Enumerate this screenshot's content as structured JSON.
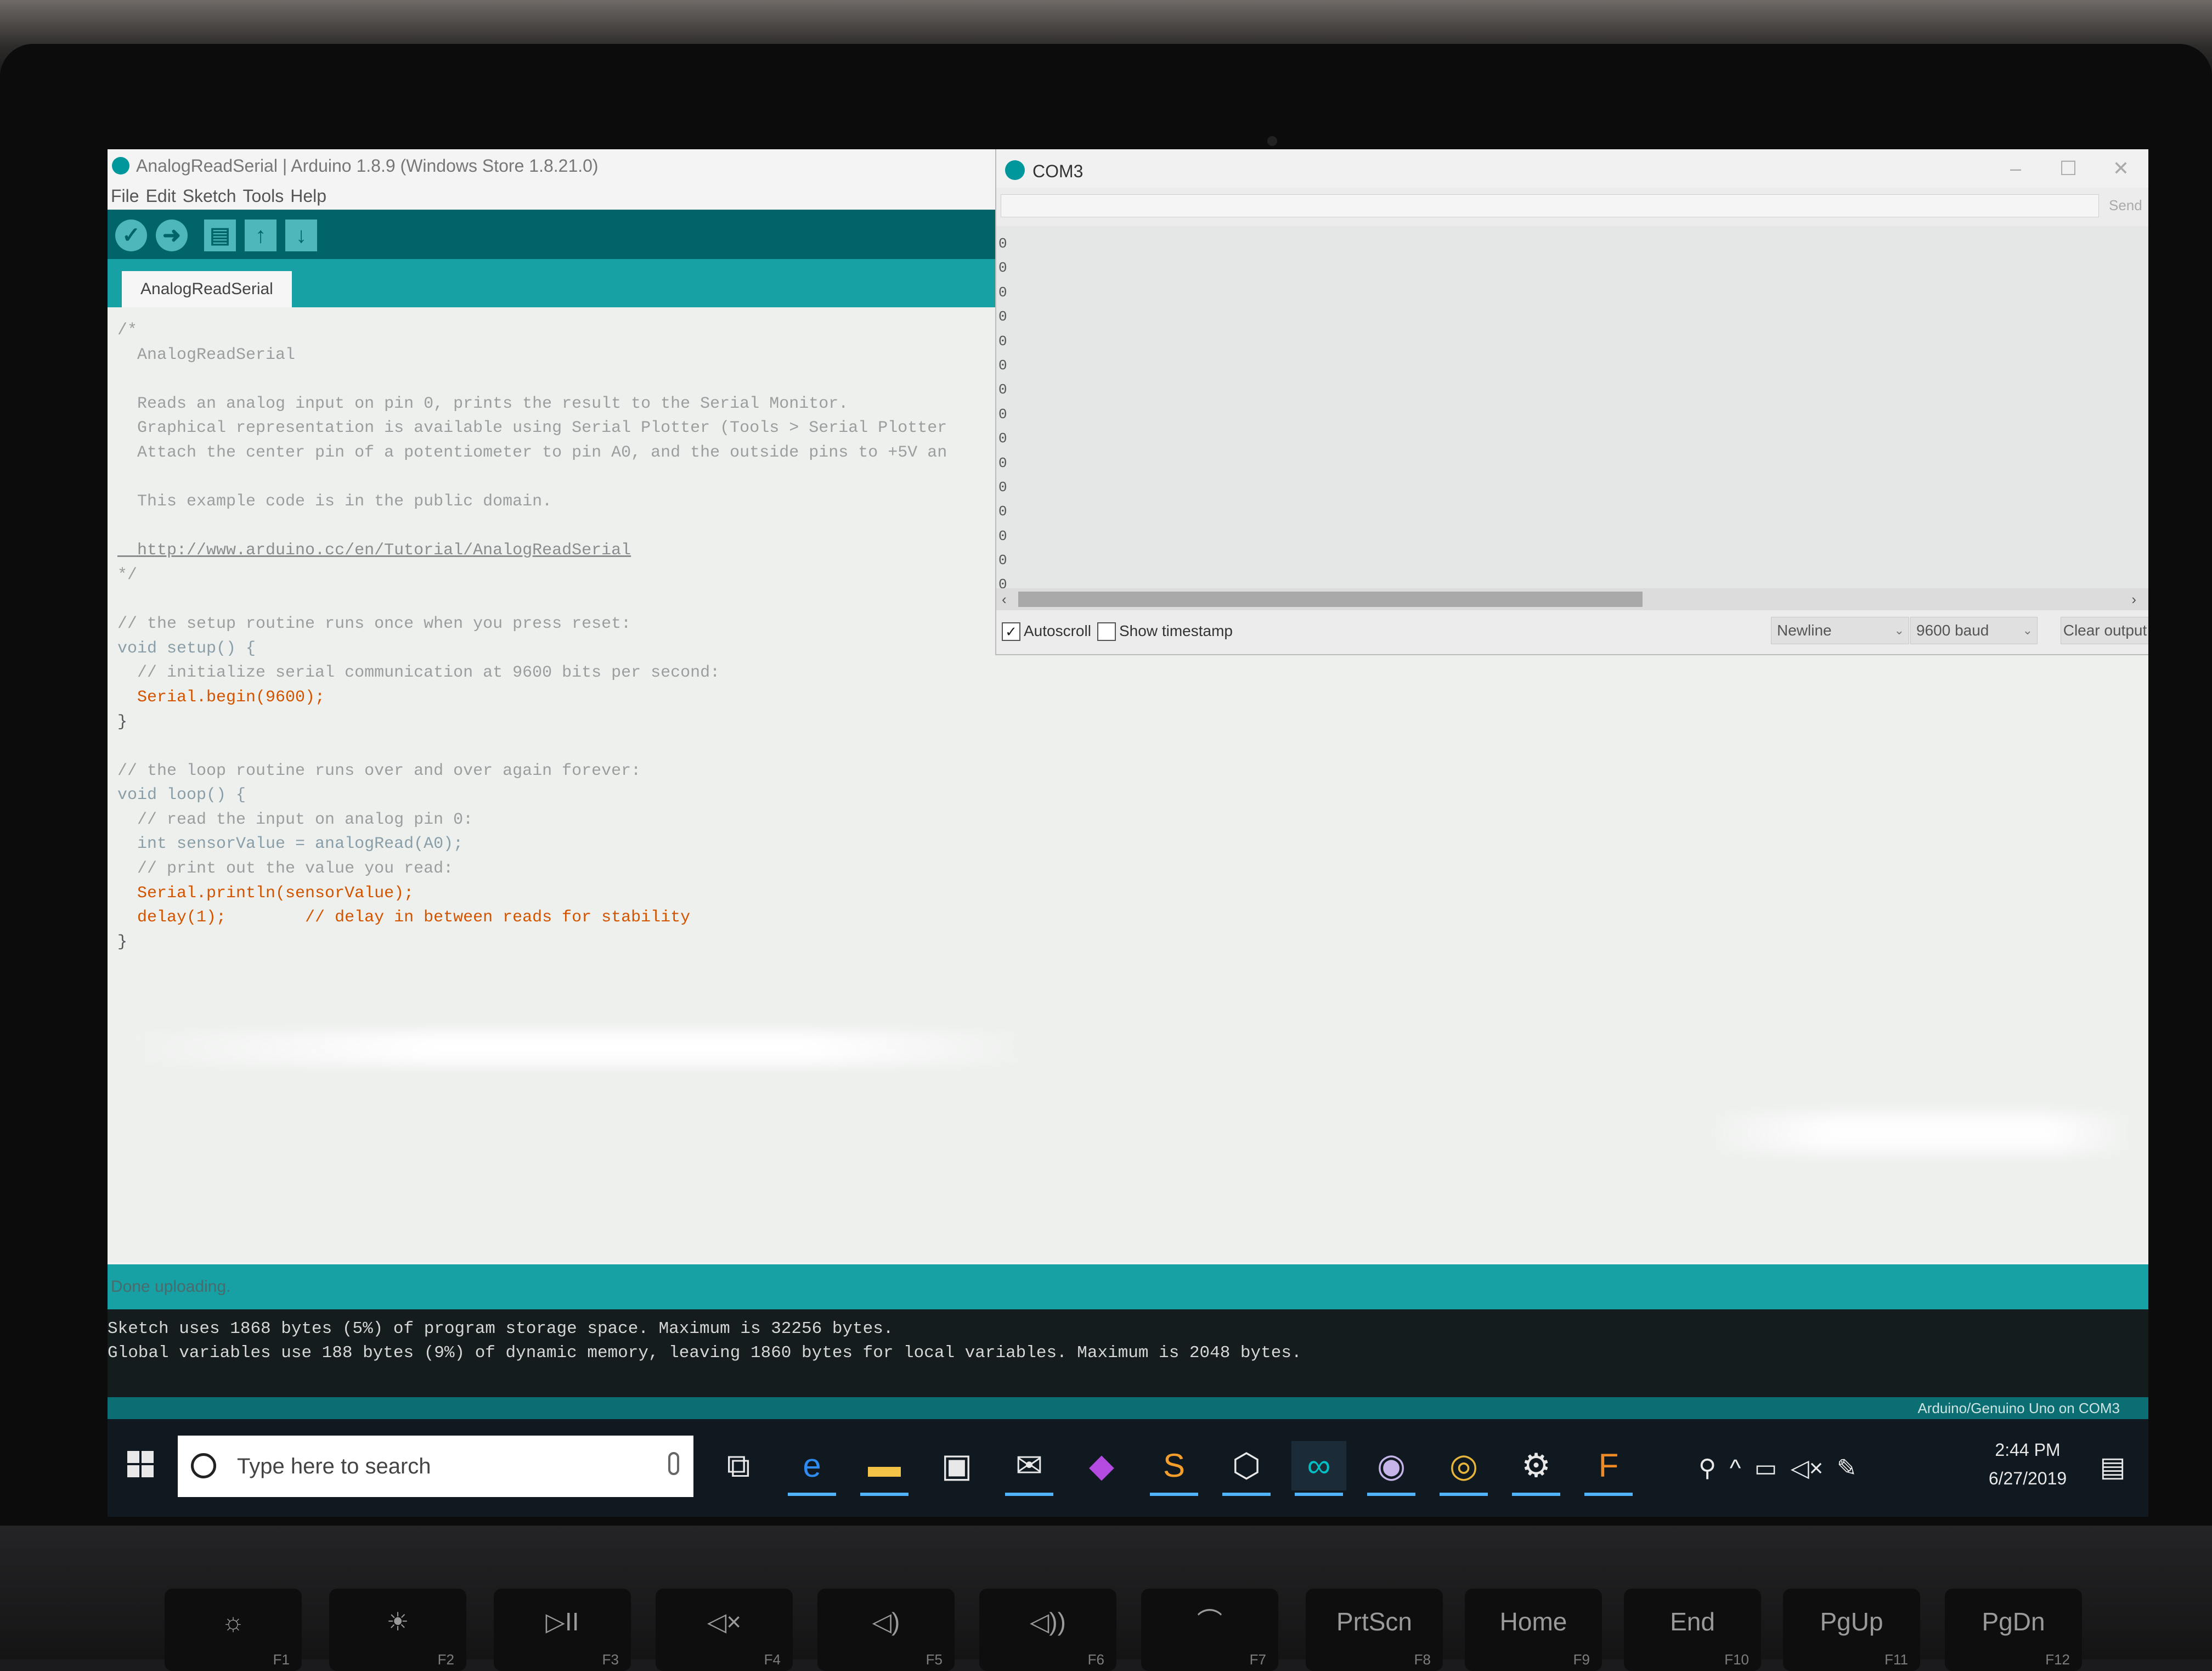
{
  "ide": {
    "window_title": "AnalogReadSerial | Arduino 1.8.9 (Windows Store 1.8.21.0)",
    "menu": [
      "File",
      "Edit",
      "Sketch",
      "Tools",
      "Help"
    ],
    "toolbar": {
      "verify_icon": "check-icon",
      "upload_icon": "arrow-right-icon",
      "new_icon": "new-file-icon",
      "open_icon": "arrow-up-icon",
      "save_icon": "arrow-down-icon"
    },
    "tab_label": "AnalogReadSerial",
    "code_lines": [
      "/*",
      "  AnalogReadSerial",
      "",
      "  Reads an analog input on pin 0, prints the result to the Serial Monitor.",
      "  Graphical representation is available using Serial Plotter (Tools > Serial Plotter",
      "  Attach the center pin of a potentiometer to pin A0, and the outside pins to +5V an",
      "",
      "  This example code is in the public domain.",
      "",
      "  http://www.arduino.cc/en/Tutorial/AnalogReadSerial",
      "*/",
      "",
      "// the setup routine runs once when you press reset:",
      "void setup() {",
      "  // initialize serial communication at 9600 bits per second:",
      "  Serial.begin(9600);",
      "}",
      "",
      "// the loop routine runs over and over again forever:",
      "void loop() {",
      "  // read the input on analog pin 0:",
      "  int sensorValue = analogRead(A0);",
      "  // print out the value you read:",
      "  Serial.println(sensorValue);",
      "  delay(1);        // delay in between reads for stability",
      "}"
    ],
    "status_text": "Done uploading.",
    "console_lines": [
      "Sketch uses 1868 bytes (5%) of program storage space. Maximum is 32256 bytes.",
      "Global variables use 188 bytes (9%) of dynamic memory, leaving 1860 bytes for local variables. Maximum is 2048 bytes."
    ],
    "board_text": "Arduino/Genuino Uno on COM3",
    "colors": {
      "teal": "#17a1a5",
      "dark_teal": "#006468",
      "console_bg": "#141c1d"
    }
  },
  "serial_monitor": {
    "title": "COM3",
    "send_label": "Send",
    "output_lines": [
      "0",
      "0",
      "0",
      "0",
      "0",
      "0",
      "0",
      "0",
      "0",
      "0",
      "0",
      "0",
      "0",
      "0",
      "0"
    ],
    "autoscroll_label": "Autoscroll",
    "autoscroll_checked": true,
    "timestamp_label": "Show timestamp",
    "timestamp_checked": false,
    "line_ending": "Newline",
    "baud": "9600 baud",
    "clear_label": "Clear output"
  },
  "taskbar": {
    "search_placeholder": "Type here to search",
    "apps": [
      "task-view-icon",
      "edge-icon",
      "file-explorer-icon",
      "store-icon",
      "mail-icon",
      "paint3d-icon",
      "sublime-icon",
      "3d-viewer-icon",
      "arduino-icon",
      "github-icon",
      "chrome-icon",
      "settings-icon",
      "fusion-icon"
    ],
    "time": "2:44 PM",
    "date": "6/27/2019"
  },
  "keyboard": {
    "keys": [
      {
        "label": "☼",
        "fn": "F1"
      },
      {
        "label": "☀",
        "fn": "F2"
      },
      {
        "label": "▷II",
        "fn": "F3"
      },
      {
        "label": "◁×",
        "fn": "F4"
      },
      {
        "label": "◁)",
        "fn": "F5"
      },
      {
        "label": "◁))",
        "fn": "F6"
      },
      {
        "label": "⌒",
        "fn": "F7"
      },
      {
        "label": "PrtScn",
        "fn": "F8"
      },
      {
        "label": "Home",
        "fn": "F9"
      },
      {
        "label": "End",
        "fn": "F10"
      },
      {
        "label": "PgUp",
        "fn": "F11"
      },
      {
        "label": "PgDn",
        "fn": "F12"
      }
    ]
  }
}
